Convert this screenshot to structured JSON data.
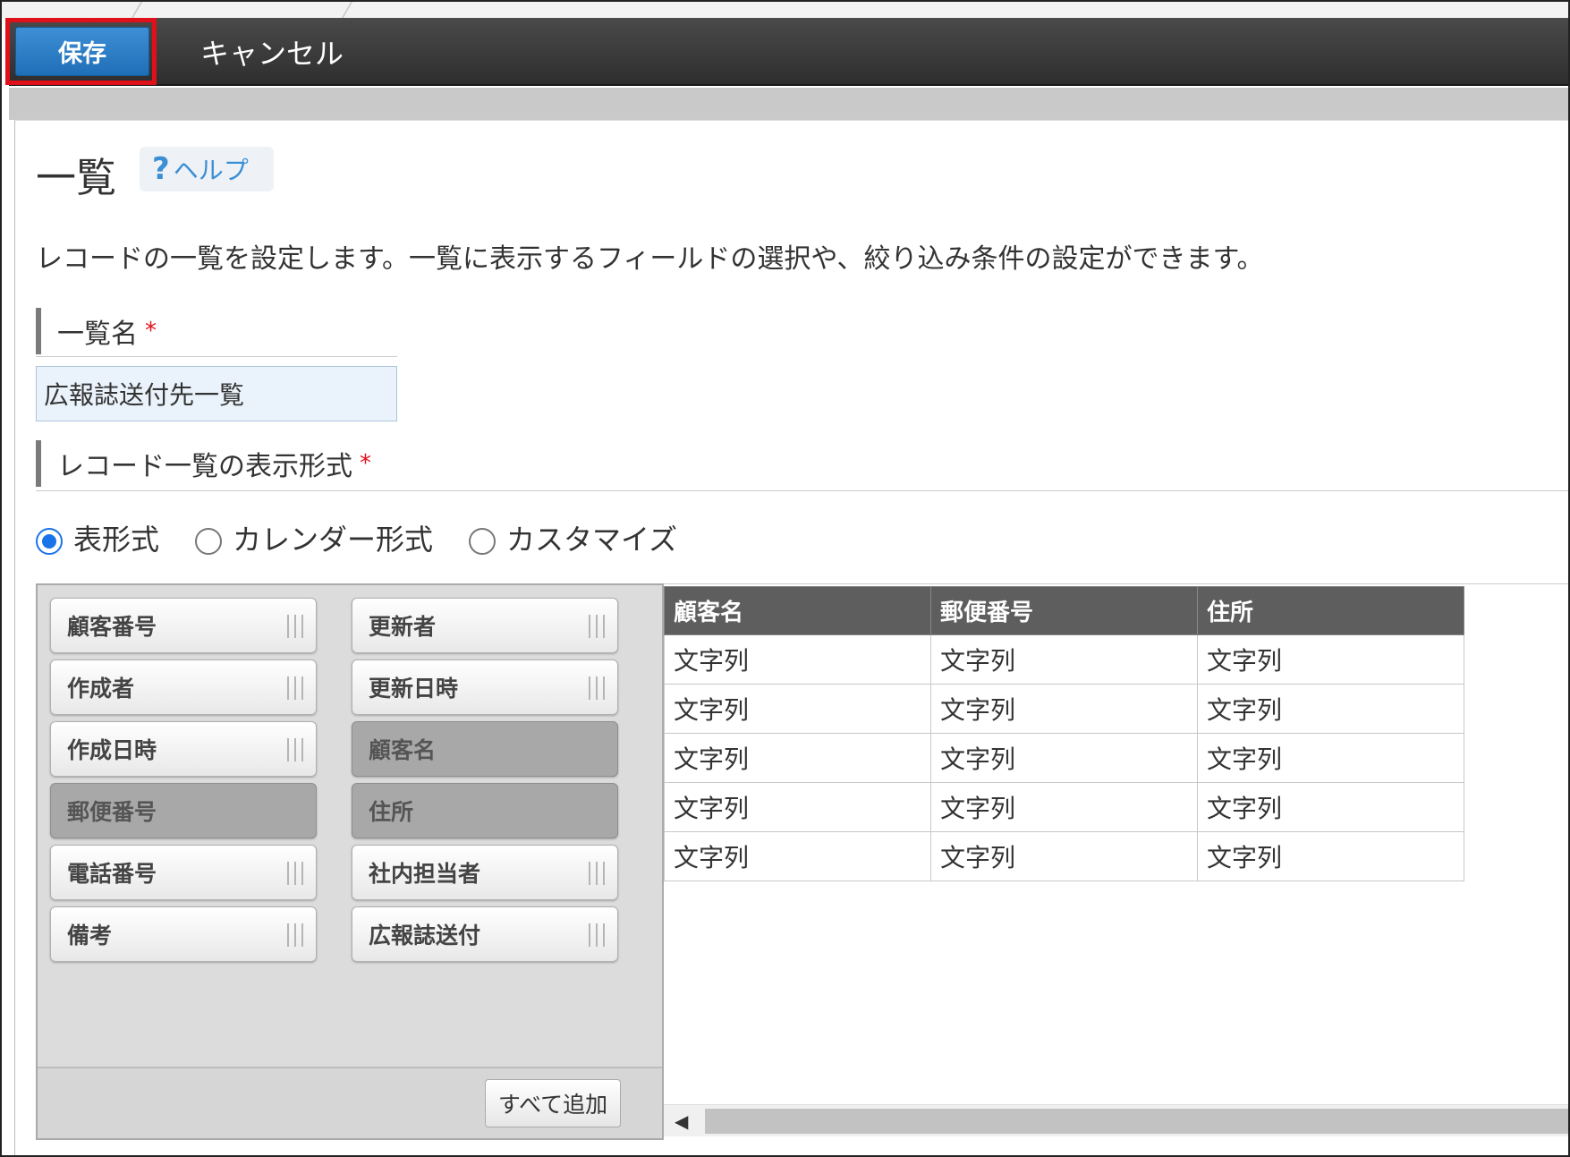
{
  "toolbar": {
    "save_label": "保存",
    "cancel_label": "キャンセル"
  },
  "page": {
    "title": "一覧",
    "help_label": "ヘルプ",
    "help_icon": "?",
    "description": "レコードの一覧を設定します。一覧に表示するフィールドの選択や、絞り込み条件の設定ができます。"
  },
  "form": {
    "name_label": "一覧名",
    "required_mark": "*",
    "name_value": "広報誌送付先一覧",
    "format_label": "レコード一覧の表示形式",
    "format_options": [
      {
        "label": "表形式",
        "selected": true
      },
      {
        "label": "カレンダー形式",
        "selected": false
      },
      {
        "label": "カスタマイズ",
        "selected": false
      }
    ]
  },
  "palette": {
    "left_fields": [
      {
        "label": "顧客番号",
        "used": false
      },
      {
        "label": "作成者",
        "used": false
      },
      {
        "label": "作成日時",
        "used": false
      },
      {
        "label": "郵便番号",
        "used": true
      },
      {
        "label": "電話番号",
        "used": false
      },
      {
        "label": "備考",
        "used": false
      }
    ],
    "right_fields": [
      {
        "label": "更新者",
        "used": false
      },
      {
        "label": "更新日時",
        "used": false
      },
      {
        "label": "顧客名",
        "used": true
      },
      {
        "label": "住所",
        "used": true
      },
      {
        "label": "社内担当者",
        "used": false
      },
      {
        "label": "広報誌送付",
        "used": false
      }
    ],
    "add_all_label": "すべて追加"
  },
  "preview": {
    "columns": [
      "顧客名",
      "郵便番号",
      "住所"
    ],
    "rows": [
      [
        "文字列",
        "文字列",
        "文字列"
      ],
      [
        "文字列",
        "文字列",
        "文字列"
      ],
      [
        "文字列",
        "文字列",
        "文字列"
      ],
      [
        "文字列",
        "文字列",
        "文字列"
      ],
      [
        "文字列",
        "文字列",
        "文字列"
      ]
    ]
  },
  "colors": {
    "accent_blue": "#1f6fb8",
    "highlight_red": "#e0101a",
    "header_gray": "#5e5e5e"
  }
}
